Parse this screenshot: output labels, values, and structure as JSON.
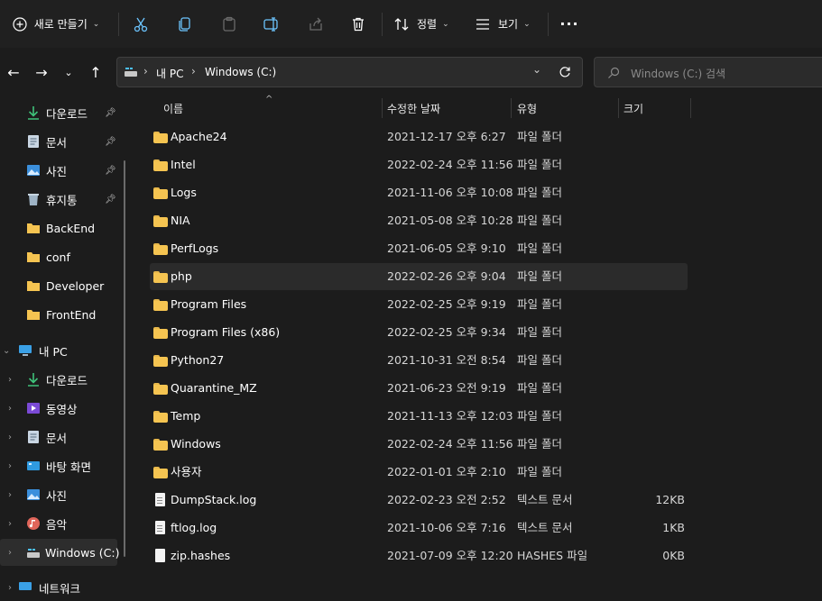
{
  "toolbar": {
    "new_label": "새로 만들기",
    "sort_label": "정렬",
    "view_label": "보기",
    "more_label": "···"
  },
  "address": {
    "segments": [
      "내 PC",
      "Windows (C:)"
    ],
    "search_placeholder": "Windows (C:) 검색"
  },
  "nav": {
    "quick_access": [
      {
        "label": "다운로드",
        "pinned": true
      },
      {
        "label": "문서",
        "pinned": true
      },
      {
        "label": "사진",
        "pinned": true
      },
      {
        "label": "휴지통",
        "pinned": true
      },
      {
        "label": "BackEnd"
      },
      {
        "label": "conf"
      },
      {
        "label": "Developer"
      },
      {
        "label": "FrontEnd"
      }
    ],
    "this_pc": {
      "label": "내 PC"
    },
    "this_pc_items": [
      {
        "label": "다운로드"
      },
      {
        "label": "동영상"
      },
      {
        "label": "문서"
      },
      {
        "label": "바탕 화면"
      },
      {
        "label": "사진"
      },
      {
        "label": "음악"
      },
      {
        "label": "Windows (C:)",
        "selected": true
      }
    ],
    "network": {
      "label": "네트워크"
    }
  },
  "columns": {
    "name": "이름",
    "modified": "수정한 날짜",
    "type": "유형",
    "size": "크기"
  },
  "files": [
    {
      "name": "Apache24",
      "modified": "2021-12-17 오후 6:27",
      "type": "파일 폴더",
      "size": "",
      "kind": "folder"
    },
    {
      "name": "Intel",
      "modified": "2022-02-24 오후 11:56",
      "type": "파일 폴더",
      "size": "",
      "kind": "folder"
    },
    {
      "name": "Logs",
      "modified": "2021-11-06 오후 10:08",
      "type": "파일 폴더",
      "size": "",
      "kind": "folder"
    },
    {
      "name": "NIA",
      "modified": "2021-05-08 오후 10:28",
      "type": "파일 폴더",
      "size": "",
      "kind": "folder"
    },
    {
      "name": "PerfLogs",
      "modified": "2021-06-05 오후 9:10",
      "type": "파일 폴더",
      "size": "",
      "kind": "folder"
    },
    {
      "name": "php",
      "modified": "2022-02-26 오후 9:04",
      "type": "파일 폴더",
      "size": "",
      "kind": "folder",
      "hover": true
    },
    {
      "name": "Program Files",
      "modified": "2022-02-25 오후 9:19",
      "type": "파일 폴더",
      "size": "",
      "kind": "folder"
    },
    {
      "name": "Program Files (x86)",
      "modified": "2022-02-25 오후 9:34",
      "type": "파일 폴더",
      "size": "",
      "kind": "folder"
    },
    {
      "name": "Python27",
      "modified": "2021-10-31 오전 8:54",
      "type": "파일 폴더",
      "size": "",
      "kind": "folder"
    },
    {
      "name": "Quarantine_MZ",
      "modified": "2021-06-23 오전 9:19",
      "type": "파일 폴더",
      "size": "",
      "kind": "folder"
    },
    {
      "name": "Temp",
      "modified": "2021-11-13 오후 12:03",
      "type": "파일 폴더",
      "size": "",
      "kind": "folder"
    },
    {
      "name": "Windows",
      "modified": "2022-02-24 오후 11:56",
      "type": "파일 폴더",
      "size": "",
      "kind": "folder"
    },
    {
      "name": "사용자",
      "modified": "2022-01-01 오후 2:10",
      "type": "파일 폴더",
      "size": "",
      "kind": "folder"
    },
    {
      "name": "DumpStack.log",
      "modified": "2022-02-23 오전 2:52",
      "type": "텍스트 문서",
      "size": "12KB",
      "kind": "text"
    },
    {
      "name": "ftlog.log",
      "modified": "2021-10-06 오후 7:16",
      "type": "텍스트 문서",
      "size": "1KB",
      "kind": "text"
    },
    {
      "name": "zip.hashes",
      "modified": "2021-07-09 오후 12:20",
      "type": "HASHES 파일",
      "size": "0KB",
      "kind": "file"
    }
  ],
  "colors": {
    "background": "#1c1c1c",
    "toolbar": "#202020",
    "folder": "#f5c451",
    "accent": "#4cc2ff"
  }
}
